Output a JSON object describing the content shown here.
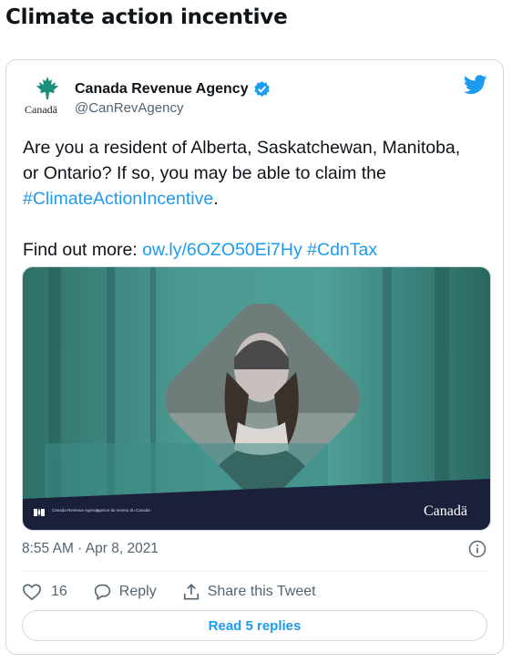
{
  "page": {
    "title": "Climate action incentive"
  },
  "tweet": {
    "author": {
      "name": "Canada Revenue Agency",
      "handle": "@CanRevAgency",
      "avatar_wordmark": "Canadä",
      "verified": true
    },
    "text": {
      "line1": "Are you a resident of Alberta, Saskatchewan, Manitoba, or Ontario? If so, you may be able to claim the ",
      "hashtag1": "#ClimateActionIncentive",
      "period": ".",
      "line2_prefix": "Find out more: ",
      "url": "ow.ly/6OZO50Ei7Hy",
      "hashtag2": "#CdnTax"
    },
    "media": {
      "footer_en": "Canada Revenue Agency",
      "footer_fr": "Agence du revenu du Canada",
      "wordmark": "Canadä"
    },
    "timestamp": "8:55 AM · Apr 8, 2021",
    "likes": "16",
    "reply_label": "Reply",
    "share_label": "Share this Tweet",
    "read_replies_label": "Read 5 replies"
  },
  "colors": {
    "link": "#1d9bf0",
    "teal": "#3d8d86",
    "dark_band": "#1a1f3a"
  }
}
